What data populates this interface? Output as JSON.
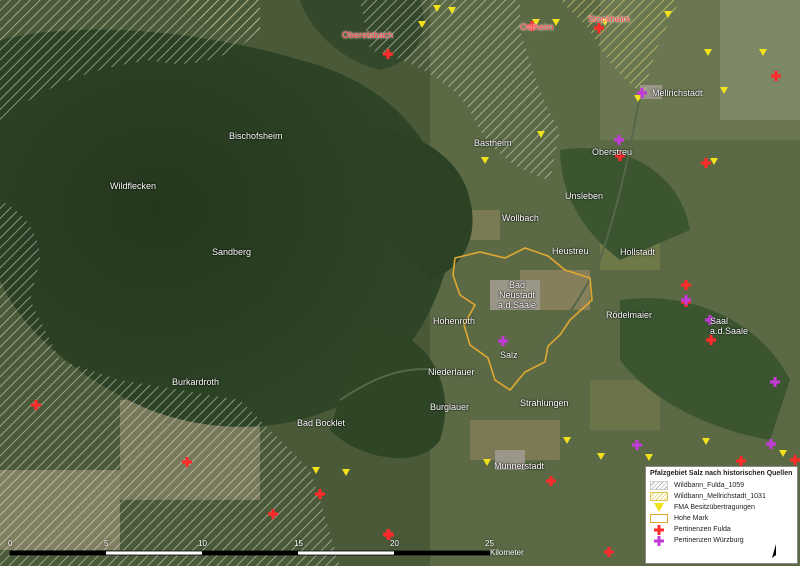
{
  "places": [
    {
      "id": "oberelsbach",
      "name": "Oberelsbach",
      "style": "red"
    },
    {
      "id": "ostheim",
      "name": "Ostheim",
      "style": "red"
    },
    {
      "id": "stockheim",
      "name": "Stockheim",
      "style": "red"
    },
    {
      "id": "mellrichstadt",
      "name": "Mellrichstadt",
      "style": "white"
    },
    {
      "id": "bischofsheim",
      "name": "Bischofsheim",
      "style": "white"
    },
    {
      "id": "bastheim",
      "name": "Bastheim",
      "style": "white"
    },
    {
      "id": "oberstreu",
      "name": "Oberstreu",
      "style": "white"
    },
    {
      "id": "wildflecken",
      "name": "Wildflecken",
      "style": "white"
    },
    {
      "id": "unsleben",
      "name": "Unsleben",
      "style": "white"
    },
    {
      "id": "wollbach",
      "name": "Wollbach",
      "style": "white"
    },
    {
      "id": "sandberg",
      "name": "Sandberg",
      "style": "white"
    },
    {
      "id": "heustreu",
      "name": "Heustreu",
      "style": "white"
    },
    {
      "id": "hollstadt",
      "name": "Hollstadt",
      "style": "white"
    },
    {
      "id": "badneustadt",
      "name": "Bad\nNeustadt\na.d.Saale",
      "style": "white"
    },
    {
      "id": "hohenroth",
      "name": "Hohenroth",
      "style": "white"
    },
    {
      "id": "rodelmaier",
      "name": "Rödelmaier",
      "style": "white"
    },
    {
      "id": "saal",
      "name": "Saal\na.d.Saale",
      "style": "white"
    },
    {
      "id": "salz",
      "name": "Salz",
      "style": "white"
    },
    {
      "id": "niederlauer",
      "name": "Niederlauer",
      "style": "white"
    },
    {
      "id": "burkardroth",
      "name": "Burkardroth",
      "style": "white"
    },
    {
      "id": "burglauer",
      "name": "Burglauer",
      "style": "white"
    },
    {
      "id": "strahlungen",
      "name": "Strahlungen",
      "style": "white"
    },
    {
      "id": "badbocklet",
      "name": "Bad Bocklet",
      "style": "white"
    },
    {
      "id": "munnerstadt",
      "name": "Münnerstadt",
      "style": "white"
    }
  ],
  "legend": {
    "title": "Pfalzgebiet Salz nach historischen Quellen",
    "items": [
      {
        "label": "Wildbann_Fulda_1059",
        "symbol": "hatch-white"
      },
      {
        "label": "Wildbann_Mellrichstadt_1031",
        "symbol": "hatch-yellow"
      },
      {
        "label": "FMA Besitzübertragungen",
        "symbol": "yellow-triangle"
      },
      {
        "label": "Hohe Mark",
        "symbol": "orange-outline"
      },
      {
        "label": "Pertinenzen Fulda",
        "symbol": "red-cross"
      },
      {
        "label": "Pertinenzen Würzburg",
        "symbol": "purple-cross"
      }
    ]
  },
  "scale": {
    "ticks": [
      "0",
      "5",
      "10",
      "15",
      "20",
      "25"
    ],
    "unit": "Kilometer"
  },
  "north_label": "N",
  "colors": {
    "fma_triangle": "#f2e21c",
    "fulda_cross": "#ff2a2a",
    "wuerzburg_cross": "#c23ad6",
    "hohe_mark": "#e0a830"
  }
}
